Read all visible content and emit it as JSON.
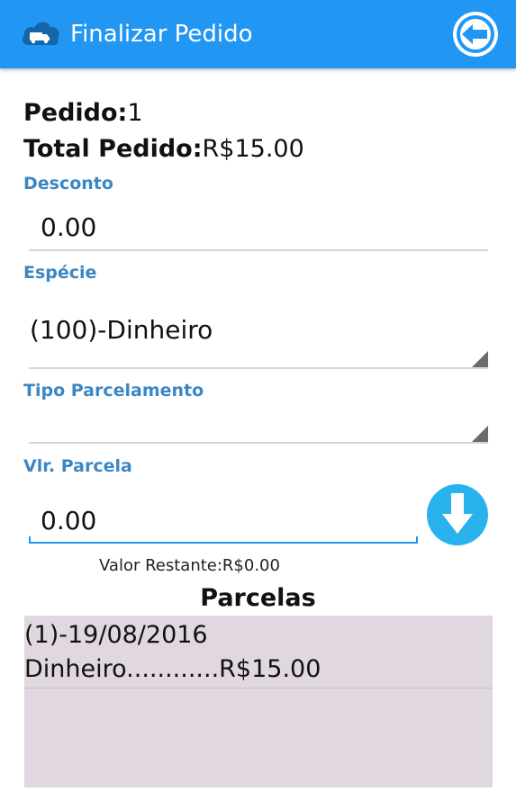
{
  "colors": {
    "appbar": "#2196f3",
    "label": "#3b87c4",
    "list_bg": "#e1d7e0",
    "action_button": "#29b2ee"
  },
  "header": {
    "title": "Finalizar Pedido",
    "logo_icon": "cloud-truck-icon",
    "back_icon": "arrow-left-icon"
  },
  "order": {
    "number_label": "Pedido:",
    "number_value": "1",
    "total_label": "Total Pedido:",
    "total_value": "R$15.00"
  },
  "form": {
    "discount": {
      "label": "Desconto",
      "value": "0.00"
    },
    "species": {
      "label": "Espécie",
      "selected": "(100)-Dinheiro"
    },
    "installment_type": {
      "label": "Tipo Parcelamento",
      "selected": ""
    },
    "installment_value": {
      "label": "Vlr. Parcela",
      "value": "0.00"
    },
    "add_icon": "arrow-down-icon",
    "remaining": "Valor Restante:R$0.00"
  },
  "installments": {
    "title": "Parcelas",
    "items": [
      {
        "line1": "(1)-19/08/2016",
        "line2": "Dinheiro............R$15.00"
      }
    ]
  }
}
